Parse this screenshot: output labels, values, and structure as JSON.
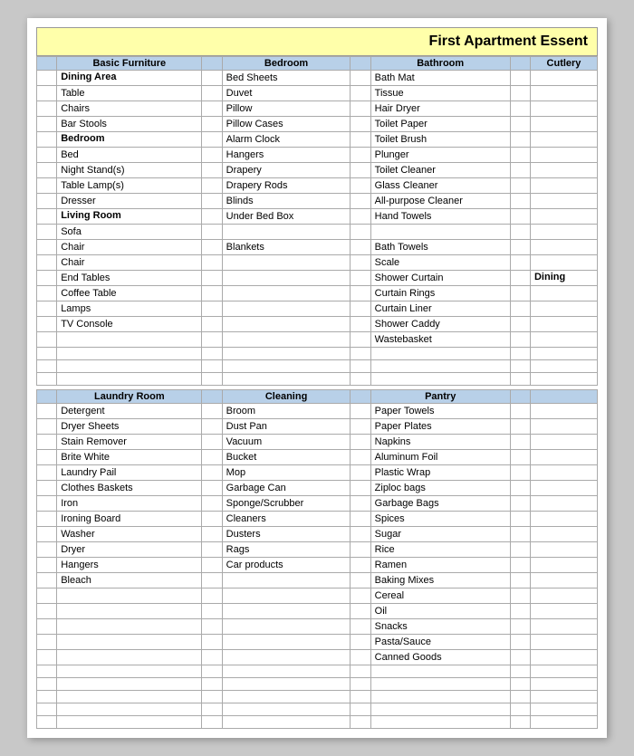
{
  "title": "First Apartment Essent",
  "columns": {
    "col1": {
      "header": "Basic Furniture"
    },
    "col2": {
      "header": "Bedroom"
    },
    "col3": {
      "header": "Bathroom"
    },
    "col4": {
      "header": ""
    }
  },
  "section1": {
    "col1": {
      "sections": [
        {
          "label": "Dining Area",
          "items": [
            "Table",
            "Chairs",
            "Bar Stools"
          ]
        },
        {
          "label": "Bedroom",
          "items": [
            "Bed",
            "Night Stand(s)",
            "Table Lamp(s)",
            "Dresser"
          ]
        },
        {
          "label": "Living Room",
          "items": [
            "Sofa",
            "Chair",
            "Chair",
            "End Tables",
            "Coffee Table",
            "Lamps",
            "TV Console"
          ]
        }
      ]
    },
    "col2": {
      "items": [
        "Bed Sheets",
        "Duvet",
        "Pillow",
        "Pillow Cases",
        "Alarm Clock",
        "Hangers",
        "Drapery",
        "Drapery Rods",
        "Blinds",
        "Under Bed Box",
        "",
        "Blankets"
      ]
    },
    "col3": {
      "items": [
        "Bath Mat",
        "Tissue",
        "Hair Dryer",
        "Toilet Paper",
        "Toilet Brush",
        "Plunger",
        "Toilet Cleaner",
        "Glass Cleaner",
        "All-purpose Cleaner",
        "Hand Towels",
        "",
        "Bath Towels",
        "Scale",
        "Shower Curtain",
        "Curtain Rings",
        "Curtain Liner",
        "Shower Caddy",
        "Wastebasket"
      ]
    },
    "col4_header": "Cutlery",
    "col4_dining": "Dining"
  },
  "section2": {
    "col1": {
      "header": "Laundry Room"
    },
    "col2": {
      "header": "Cleaning"
    },
    "col3": {
      "header": "Pantry"
    },
    "col4": {
      "header": ""
    }
  },
  "laundry": [
    "Detergent",
    "Dryer Sheets",
    "Stain Remover",
    "Brite White",
    "Laundry Pail",
    "Clothes Baskets",
    "Iron",
    "Ironing Board",
    "Washer",
    "Dryer",
    "Hangers",
    "Bleach"
  ],
  "cleaning": [
    "Broom",
    "Dust Pan",
    "Vacuum",
    "Bucket",
    "Mop",
    "Garbage Can",
    "Sponge/Scrubber",
    "Cleaners",
    "Dusters",
    "Rags",
    "Car products"
  ],
  "pantry": [
    "Paper Towels",
    "Paper Plates",
    "Napkins",
    "Aluminum Foil",
    "Plastic Wrap",
    "Ziploc bags",
    "Garbage Bags",
    "Spices",
    "Sugar",
    "Rice",
    "Ramen",
    "Baking Mixes",
    "Cereal",
    "Oil",
    "Snacks",
    "Pasta/Sauce",
    "Canned Goods"
  ]
}
